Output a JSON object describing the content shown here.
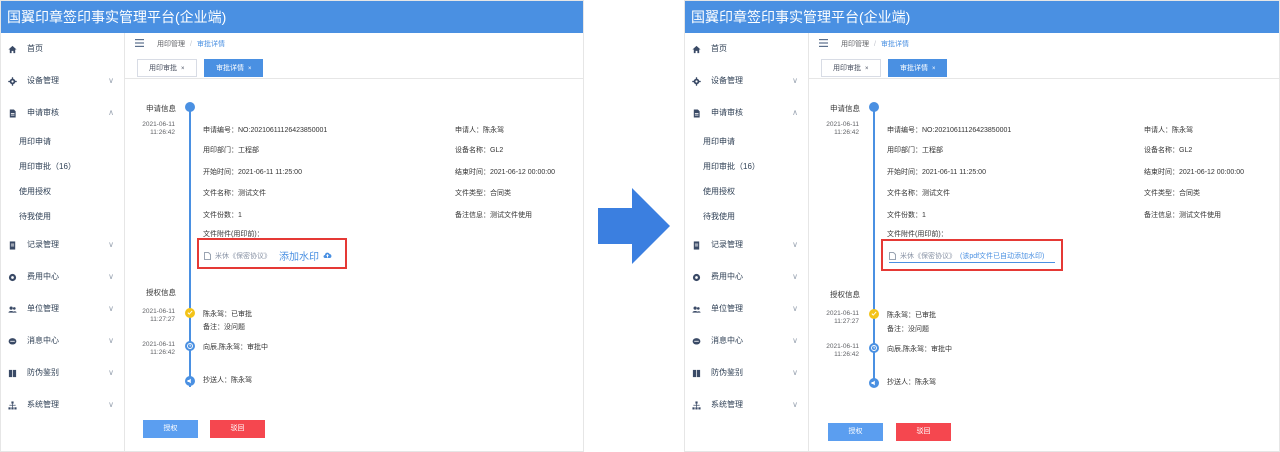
{
  "app_title": "国翼印章签印事实管理平台(企业端)",
  "sidebar": {
    "items": [
      {
        "label": "首页",
        "icon": "home-icon",
        "chevron": ""
      },
      {
        "label": "设备管理",
        "icon": "gear-icon",
        "chevron": "∨"
      },
      {
        "label": "申请审核",
        "icon": "document-icon",
        "chevron": "∧"
      },
      {
        "label": "记录管理",
        "icon": "record-icon",
        "chevron": "∨"
      },
      {
        "label": "费用中心",
        "icon": "fee-icon",
        "chevron": "∨"
      },
      {
        "label": "单位管理",
        "icon": "users-icon",
        "chevron": "∨"
      },
      {
        "label": "消息中心",
        "icon": "message-icon",
        "chevron": "∨"
      },
      {
        "label": "防伪鉴别",
        "icon": "shield-icon",
        "chevron": "∨"
      },
      {
        "label": "系统管理",
        "icon": "org-icon",
        "chevron": "∨"
      }
    ],
    "subitems": [
      "用印申请",
      "用印审批（16）",
      "使用授权",
      "待我使用"
    ]
  },
  "breadcrumb": {
    "parent": "用印管理",
    "current": "审批详情",
    "sep": "/"
  },
  "tabs": [
    {
      "label": "用印审批",
      "close": "×"
    },
    {
      "label": "审批详情",
      "close": "×"
    }
  ],
  "application": {
    "section_title": "申请信息",
    "timestamp_date": "2021-06-11",
    "timestamp_time": "11:26:42",
    "fields": {
      "apply_no": "申请编号：NO:20210611126423850001",
      "applicant": "申请人：陈永驾",
      "dept": "用印部门：工程部",
      "device": "设备名称：GL2",
      "start_time": "开始时间：2021-06-11 11:25:00",
      "end_time": "结束时间：2021-06-12 00:00:00",
      "file_name": "文件名称：测试文件",
      "file_type": "文件类型：合同类",
      "file_count": "文件份数：1",
      "remark": "备注信息：测试文件使用",
      "attachment_label": "文件附件(用印前)："
    },
    "file_before": {
      "name": "米休《保密协议》",
      "action": "添加水印"
    },
    "file_after": {
      "name": "米休《保密协议》",
      "note": "(该pdf文件已自动添加水印)"
    }
  },
  "authorization": {
    "section_title": "授权信息",
    "events": [
      {
        "date": "2021-06-11",
        "time": "11:27:27",
        "line1": "陈永驾：已审批",
        "line2": "备注：没问题"
      },
      {
        "date": "2021-06-11",
        "time": "11:26:42",
        "line1": "向辰,陈永驾：审批中",
        "line2": ""
      },
      {
        "date": "",
        "time": "",
        "line1": "抄送人：陈永驾",
        "line2": ""
      }
    ]
  },
  "buttons": {
    "authorize": "授权",
    "reject": "驳回"
  },
  "colors": {
    "primary": "#4a90e2",
    "danger": "#f5474f",
    "highlight": "#e53935",
    "check": "#f3c318",
    "arrow": "#3b7fe0"
  }
}
